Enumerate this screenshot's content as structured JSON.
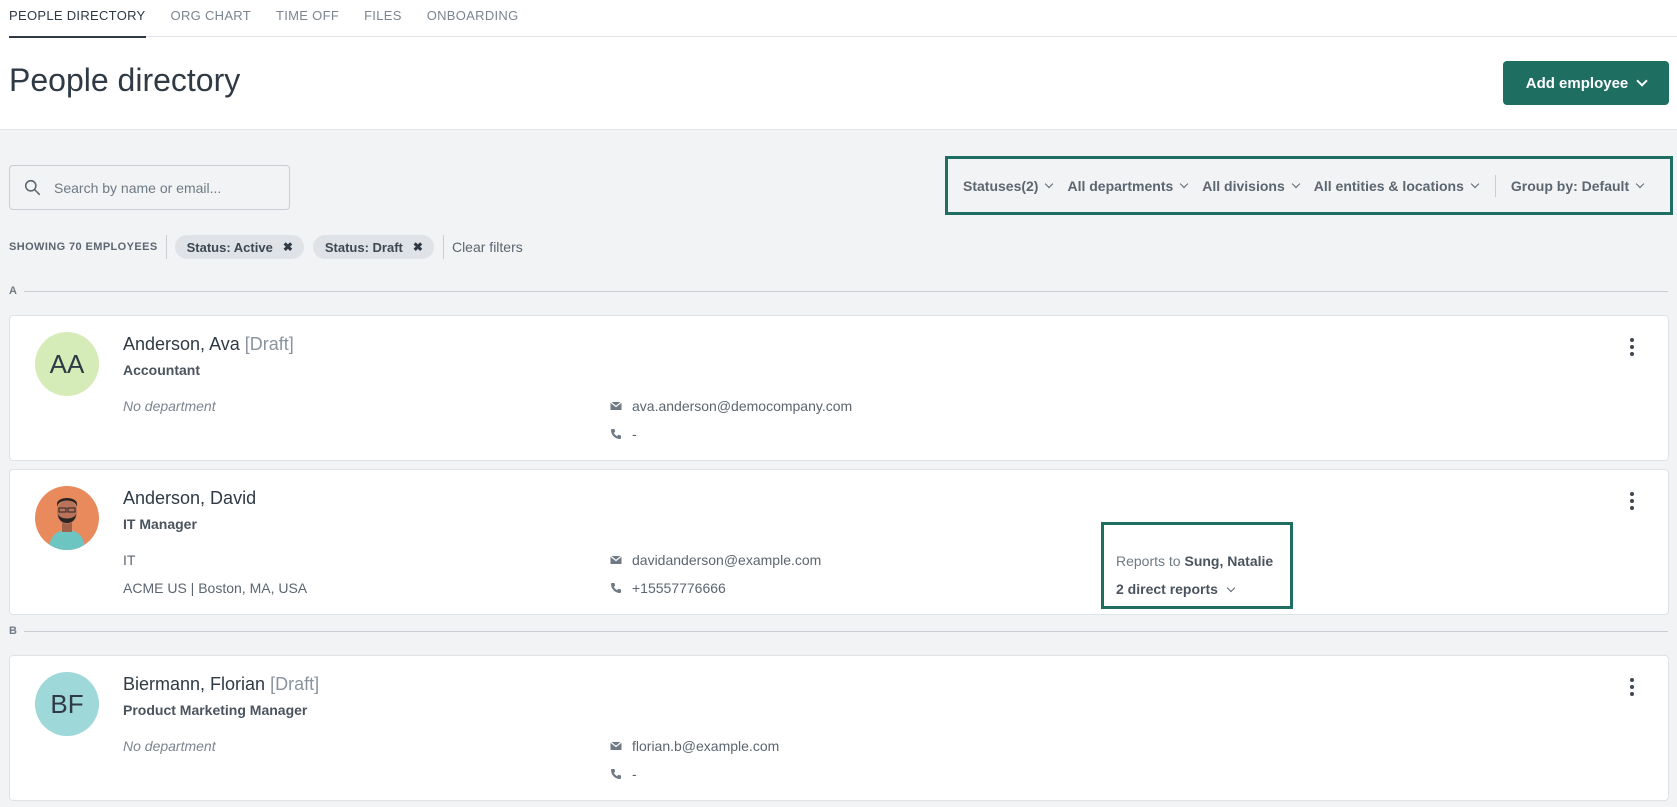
{
  "tabs": [
    {
      "label": "PEOPLE DIRECTORY",
      "active": true
    },
    {
      "label": "ORG CHART",
      "active": false
    },
    {
      "label": "TIME OFF",
      "active": false
    },
    {
      "label": "FILES",
      "active": false
    },
    {
      "label": "ONBOARDING",
      "active": false
    }
  ],
  "header": {
    "title": "People directory",
    "add_button_label": "Add employee"
  },
  "search": {
    "placeholder": "Search by name or email..."
  },
  "filters": {
    "statuses": "Statuses(2)",
    "departments": "All departments",
    "divisions": "All divisions",
    "entities": "All entities & locations",
    "group_by": "Group by: Default"
  },
  "filterbar": {
    "count": "SHOWING 70 EMPLOYEES",
    "chips": [
      "Status: Active",
      "Status: Draft"
    ],
    "chip_close": "✖",
    "clear": "Clear filters"
  },
  "groups": {
    "a": "A",
    "b": "B"
  },
  "employees": [
    {
      "initials": "AA",
      "avatar_color": "#d6ecb8",
      "name": "Anderson, Ava",
      "draft": "[Draft]",
      "role": "Accountant",
      "department": "No department",
      "email": "ava.anderson@democompany.com",
      "phone": "-"
    },
    {
      "initials": "",
      "avatar_color": "#e88a5c",
      "name": "Anderson, David",
      "role": "IT Manager",
      "department": "IT",
      "location": "ACME US | Boston, MA, USA",
      "email": "davidanderson@example.com",
      "phone": "+15557776666",
      "reports_to_label": "Reports to",
      "reports_to_name": "Sung, Natalie",
      "direct_reports": "2 direct reports"
    },
    {
      "initials": "BF",
      "avatar_color": "#9ed8d8",
      "name": "Biermann, Florian",
      "draft": "[Draft]",
      "role": "Product Marketing Manager",
      "department": "No department",
      "email": "florian.b@example.com",
      "phone": "-"
    }
  ],
  "colors": {
    "primary": "#1f6e62",
    "background": "#f2f3f5"
  }
}
